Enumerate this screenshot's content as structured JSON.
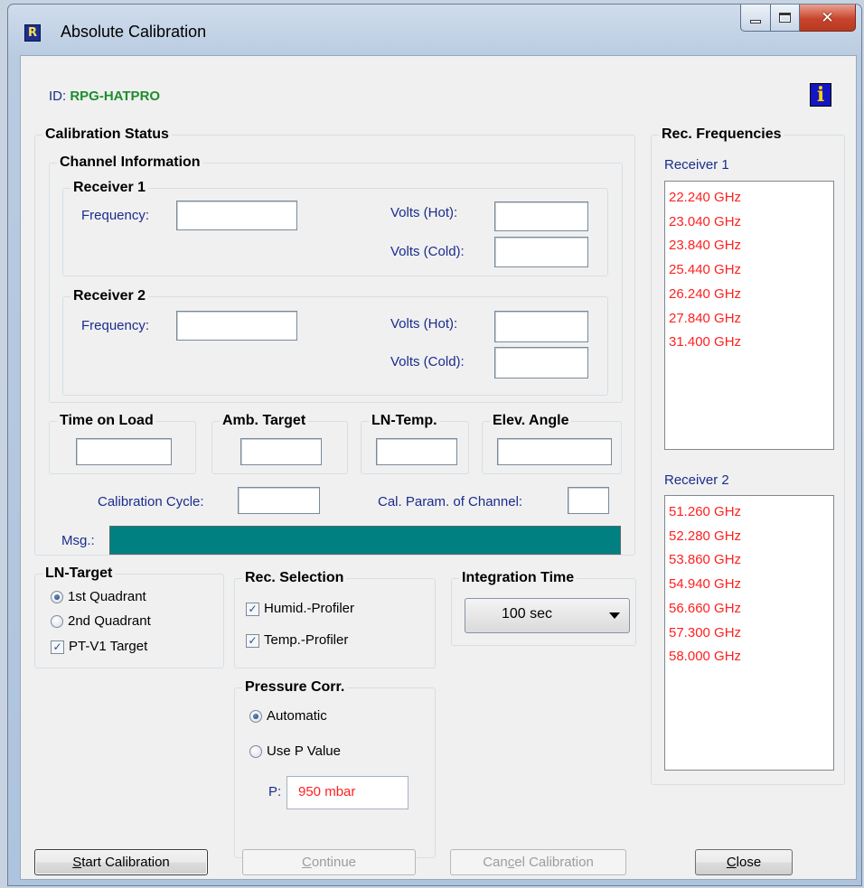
{
  "window": {
    "title": "Absolute Calibration",
    "app_icon_glyph": "R"
  },
  "id": {
    "label": "ID:",
    "value": "RPG-HATPRO"
  },
  "calibration_status": {
    "title": "Calibration Status",
    "channel_information": {
      "title": "Channel Information",
      "receiver1": {
        "title": "Receiver 1",
        "frequency_label": "Frequency:",
        "volts_hot_label": "Volts (Hot):",
        "volts_cold_label": "Volts (Cold):"
      },
      "receiver2": {
        "title": "Receiver 2",
        "frequency_label": "Frequency:",
        "volts_hot_label": "Volts (Hot):",
        "volts_cold_label": "Volts (Cold):"
      }
    },
    "time_on_load": "Time on Load",
    "amb_target": "Amb. Target",
    "ln_temp": "LN-Temp.",
    "elev_angle": "Elev. Angle",
    "calibration_cycle_label": "Calibration Cycle:",
    "cal_param_label": "Cal. Param. of Channel:",
    "msg_label": "Msg.:"
  },
  "rec_frequencies": {
    "title": "Rec. Frequencies",
    "receiver1_label": "Receiver 1",
    "receiver1": [
      "22.240 GHz",
      "23.040 GHz",
      "23.840 GHz",
      "25.440 GHz",
      "26.240 GHz",
      "27.840 GHz",
      "31.400 GHz"
    ],
    "receiver2_label": "Receiver 2",
    "receiver2": [
      "51.260 GHz",
      "52.280 GHz",
      "53.860 GHz",
      "54.940 GHz",
      "56.660 GHz",
      "57.300 GHz",
      "58.000 GHz"
    ]
  },
  "ln_target": {
    "title": "LN-Target",
    "option1": "1st Quadrant",
    "option2": "2nd Quadrant",
    "checkbox": "PT-V1 Target",
    "selected": "1st Quadrant",
    "checked": true
  },
  "rec_selection": {
    "title": "Rec. Selection",
    "humid": "Humid.-Profiler",
    "temp": "Temp.-Profiler",
    "humid_checked": true,
    "temp_checked": true
  },
  "integration_time": {
    "title": "Integration Time",
    "value": "100 sec"
  },
  "pressure_corr": {
    "title": "Pressure Corr.",
    "automatic": "Automatic",
    "use_p": "Use P Value",
    "selected": "Automatic",
    "p_label": "P:",
    "p_value": "950 mbar"
  },
  "buttons": {
    "start_prefix": "S",
    "start_rest": "tart Calibration",
    "continue_prefix": "C",
    "continue_rest": "ontinue",
    "cancel_a": "Can",
    "cancel_u": "c",
    "cancel_b": "el Calibration",
    "close_prefix": "C",
    "close_rest": "lose"
  },
  "colors": {
    "accent_green": "#1e8c2e",
    "label_blue": "#1a2c8c",
    "freq_red": "#ff2020",
    "msg_teal": "#008080"
  }
}
